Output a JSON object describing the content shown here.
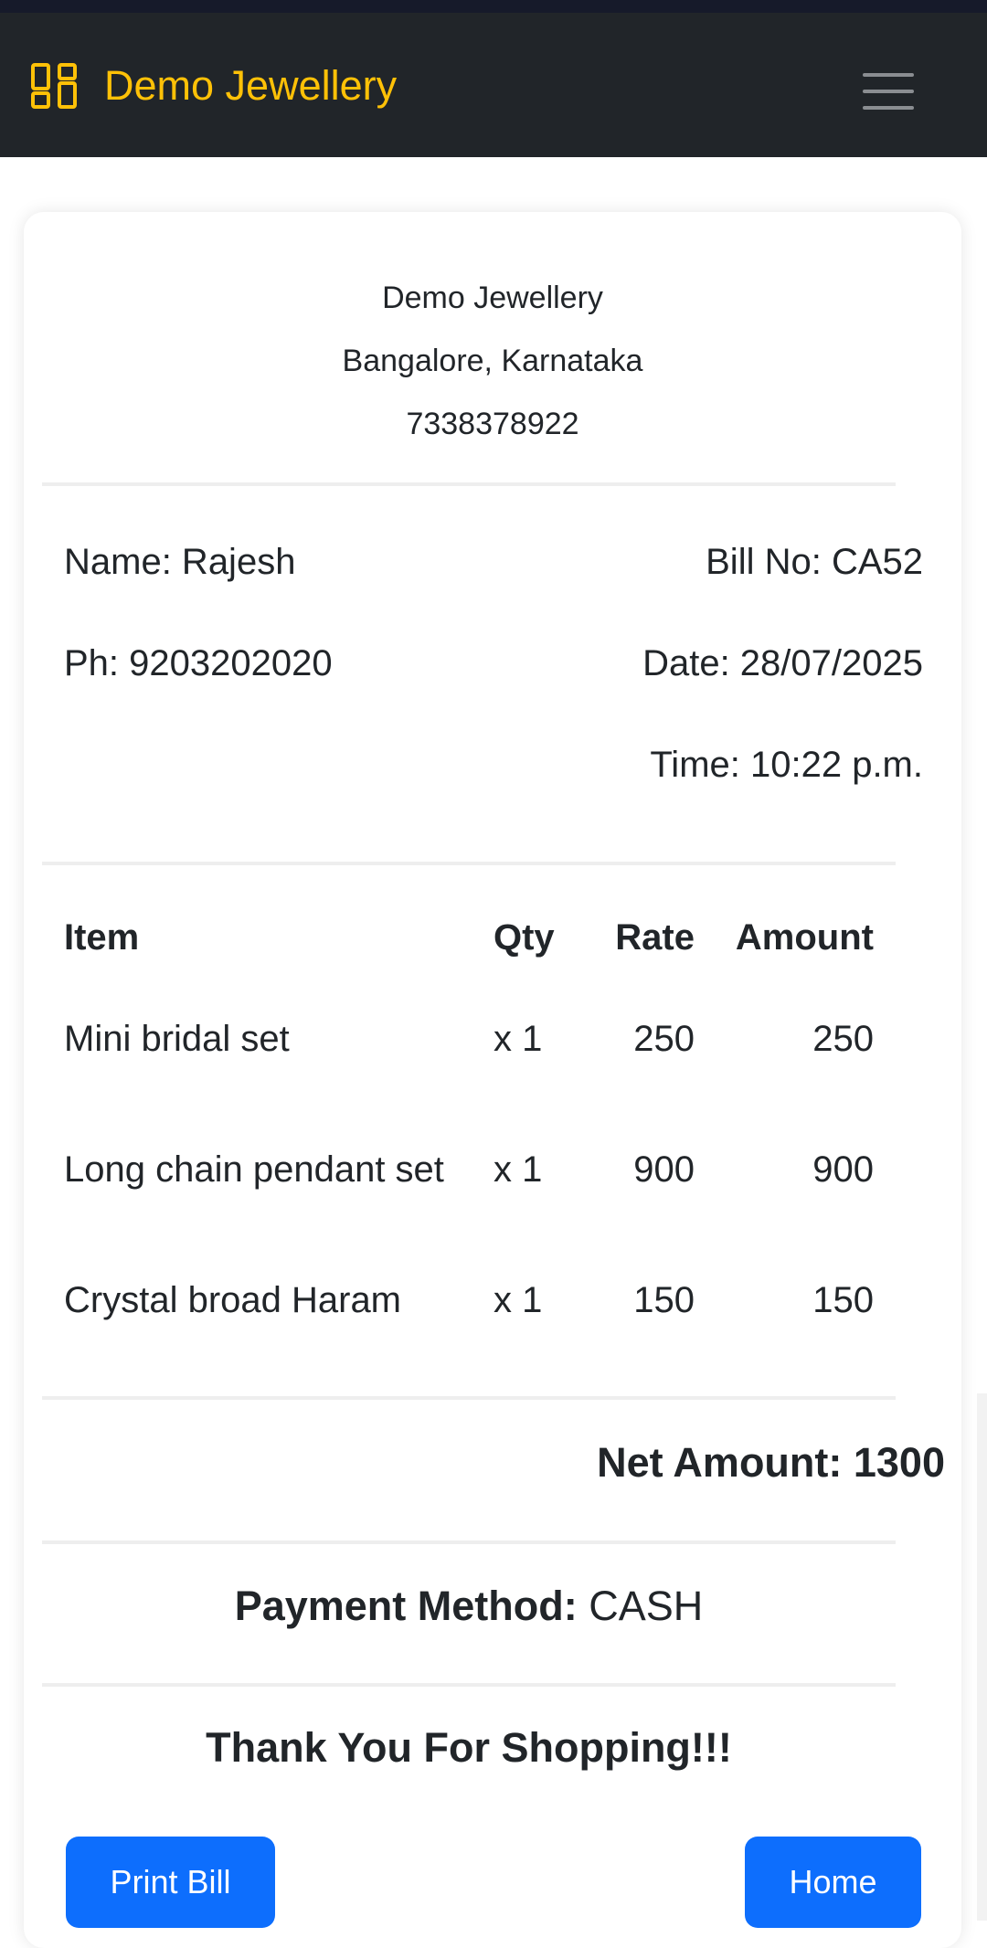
{
  "navbar": {
    "brand": "Demo Jewellery",
    "brand_icon": "grid-layout-icon",
    "menu_icon": "hamburger-menu-icon",
    "brand_color": "#ffc107",
    "background": "#212529"
  },
  "store": {
    "name": "Demo Jewellery",
    "location": "Bangalore, Karnataka",
    "phone": "7338378922"
  },
  "bill": {
    "name": "Name: Rajesh",
    "phone": "Ph: 9203202020",
    "bill_no": "Bill No: CA52",
    "date": "Date: 28/07/2025",
    "time": "Time: 10:22 p.m."
  },
  "table": {
    "headers": [
      "Item",
      "Qty",
      "Rate",
      "Amount"
    ],
    "rows": [
      {
        "item": "Mini bridal set",
        "qty": "x 1",
        "rate": "250",
        "amount": "250"
      },
      {
        "item": "Long chain pendant set",
        "qty": "x 1",
        "rate": "900",
        "amount": "900"
      },
      {
        "item": "Crystal broad Haram",
        "qty": "x 1",
        "rate": "150",
        "amount": "150"
      }
    ]
  },
  "summary": {
    "net_amount": "Net Amount: 1300",
    "payment_label": "Payment Method:",
    "payment_value": "CASH",
    "thanks": "Thank You For Shopping!!!"
  },
  "buttons": {
    "print": "Print Bill",
    "home": "Home",
    "color": "#0d6efd"
  }
}
